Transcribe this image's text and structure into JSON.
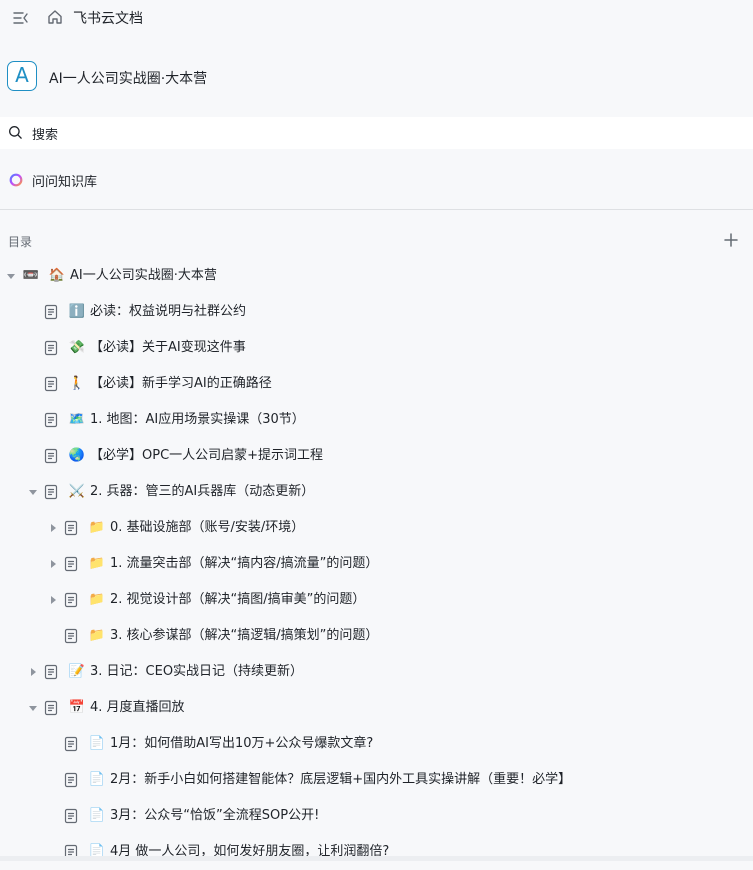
{
  "app": {
    "brand": "飞书云文档"
  },
  "space": {
    "logo_letter": "A",
    "title": "AI一人公司实战圈·大本营"
  },
  "search": {
    "label": "搜索"
  },
  "ask": {
    "label": "问问知识库"
  },
  "toc": {
    "label": "目录"
  },
  "colors": {
    "accent": "#1f8fc4",
    "text": "#1f2329",
    "muted": "#646a73",
    "divider": "#dee0e3"
  },
  "tree": [
    {
      "level": 0,
      "caret": "expanded",
      "doc": false,
      "prefix": "📼",
      "icon": "🏠",
      "label": "AI一人公司实战圈·大本营"
    },
    {
      "level": 1,
      "caret": "none",
      "doc": true,
      "icon": "ℹ️",
      "label": "必读：权益说明与社群公约"
    },
    {
      "level": 1,
      "caret": "none",
      "doc": true,
      "icon": "💸",
      "label": "【必读】关于AI变现这件事"
    },
    {
      "level": 1,
      "caret": "none",
      "doc": true,
      "icon": "🚶",
      "label": "【必读】新手学习AI的正确路径"
    },
    {
      "level": 1,
      "caret": "none",
      "doc": true,
      "icon": "🗺️",
      "label": "1. 地图：AI应用场景实操课（30节）"
    },
    {
      "level": 1,
      "caret": "none",
      "doc": true,
      "icon": "🌏",
      "label": "【必学】OPC一人公司启蒙+提示词工程"
    },
    {
      "level": 1,
      "caret": "expanded",
      "doc": true,
      "icon": "⚔️",
      "label": "2. 兵器：管三的AI兵器库（动态更新）"
    },
    {
      "level": 2,
      "caret": "collapsed",
      "doc": true,
      "icon": "📁",
      "label": "0. 基础设施部（账号/安装/环境）"
    },
    {
      "level": 2,
      "caret": "collapsed",
      "doc": true,
      "icon": "📁",
      "label": "1. 流量突击部（解决“搞内容/搞流量”的问题）"
    },
    {
      "level": 2,
      "caret": "collapsed",
      "doc": true,
      "icon": "📁",
      "label": "2. 视觉设计部（解决“搞图/搞审美”的问题）"
    },
    {
      "level": 2,
      "caret": "none",
      "doc": true,
      "icon": "📁",
      "label": "3. 核心参谋部（解决“搞逻辑/搞策划”的问题）"
    },
    {
      "level": 1,
      "caret": "collapsed",
      "doc": true,
      "icon": "📝",
      "label": "3. 日记：CEO实战日记（持续更新）"
    },
    {
      "level": 1,
      "caret": "expanded",
      "doc": true,
      "icon": "📅",
      "label": "4. 月度直播回放"
    },
    {
      "level": 2,
      "caret": "none",
      "doc": true,
      "icon": "📄",
      "label": "1月：如何借助AI写出10万+公众号爆款文章?"
    },
    {
      "level": 2,
      "caret": "none",
      "doc": true,
      "icon": "📄",
      "label": "2月：新手小白如何搭建智能体？底层逻辑+国内外工具实操讲解（重要！必学】"
    },
    {
      "level": 2,
      "caret": "none",
      "doc": true,
      "icon": "📄",
      "label": "3月：公众号“恰饭”全流程SOP公开!"
    },
    {
      "level": 2,
      "caret": "none",
      "doc": true,
      "icon": "📄",
      "label": "4月 做一人公司，如何发好朋友圈，让利润翻倍?"
    }
  ]
}
